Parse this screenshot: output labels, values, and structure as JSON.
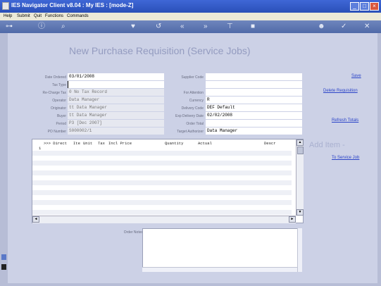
{
  "window": {
    "title": "IES Navigator Client v8.04 : My IES :     [mode-Z]",
    "minimize": "_",
    "restore": "□",
    "close": "×"
  },
  "menu": [
    "Help",
    "Submit",
    "Quit",
    "Functions",
    "Commands"
  ],
  "toolbar_icons": [
    "key-icon",
    "info-icon",
    "search-icon",
    "heart-icon",
    "undo-icon",
    "back-icon",
    "forward-icon",
    "tree-icon",
    "stop-icon",
    "person-icon",
    "check-icon",
    "close-icon"
  ],
  "page_title": "New Purchase Requisition (Service Jobs)",
  "form": {
    "left": [
      {
        "label": "Date Ordered",
        "value": "03/01/2008",
        "readonly": false
      },
      {
        "label": "Tax Type",
        "value": "",
        "readonly": false
      },
      {
        "label": "Re-Charge Tax",
        "value": "0 No Tax Record",
        "readonly": true
      },
      {
        "label": "Operator",
        "value": "Data Manager",
        "readonly": true
      },
      {
        "label": "Originator",
        "value": "tt Data Manager",
        "readonly": true
      },
      {
        "label": "Buyer",
        "value": "tt Data Manager",
        "readonly": true
      },
      {
        "label": "Period",
        "value": "P3  [Dec 2007]",
        "readonly": true
      },
      {
        "label": "PO Number",
        "value": "S000002/1",
        "readonly": true
      }
    ],
    "right": [
      {
        "label": "Supplier Code",
        "value": ""
      },
      {
        "label": "",
        "value": ""
      },
      {
        "label": "For Attention",
        "value": ""
      },
      {
        "label": "Currency",
        "value": "R"
      },
      {
        "label": "Delivery Code",
        "value": "DEF Default"
      },
      {
        "label": "Exp Delivery Date",
        "value": "02/02/2008"
      },
      {
        "label": "Order Total",
        "value": ""
      },
      {
        "label": "Target Authorizer",
        "value": "Data Manager"
      }
    ]
  },
  "actions": {
    "save": "Save",
    "delete": "Delete Requisition",
    "refresh": "Refresh Totals",
    "add_item": "Add Item -",
    "to_service_job": "To Service Job"
  },
  "grid": {
    "headers": [
      ">>> Direct",
      "Ite",
      "Unit",
      "Tax",
      "Incl Price",
      "Quantity",
      "Actual",
      "Descr"
    ],
    "rows": [
      "1",
      "",
      "",
      "",
      "",
      "",
      "",
      "",
      "",
      "",
      "",
      "",
      "",
      ""
    ]
  },
  "notes": {
    "label": "Order Notes"
  },
  "colors": {
    "titlebar": "#2f57c4",
    "background": "#ccd1e6",
    "link": "#2b44c8"
  }
}
